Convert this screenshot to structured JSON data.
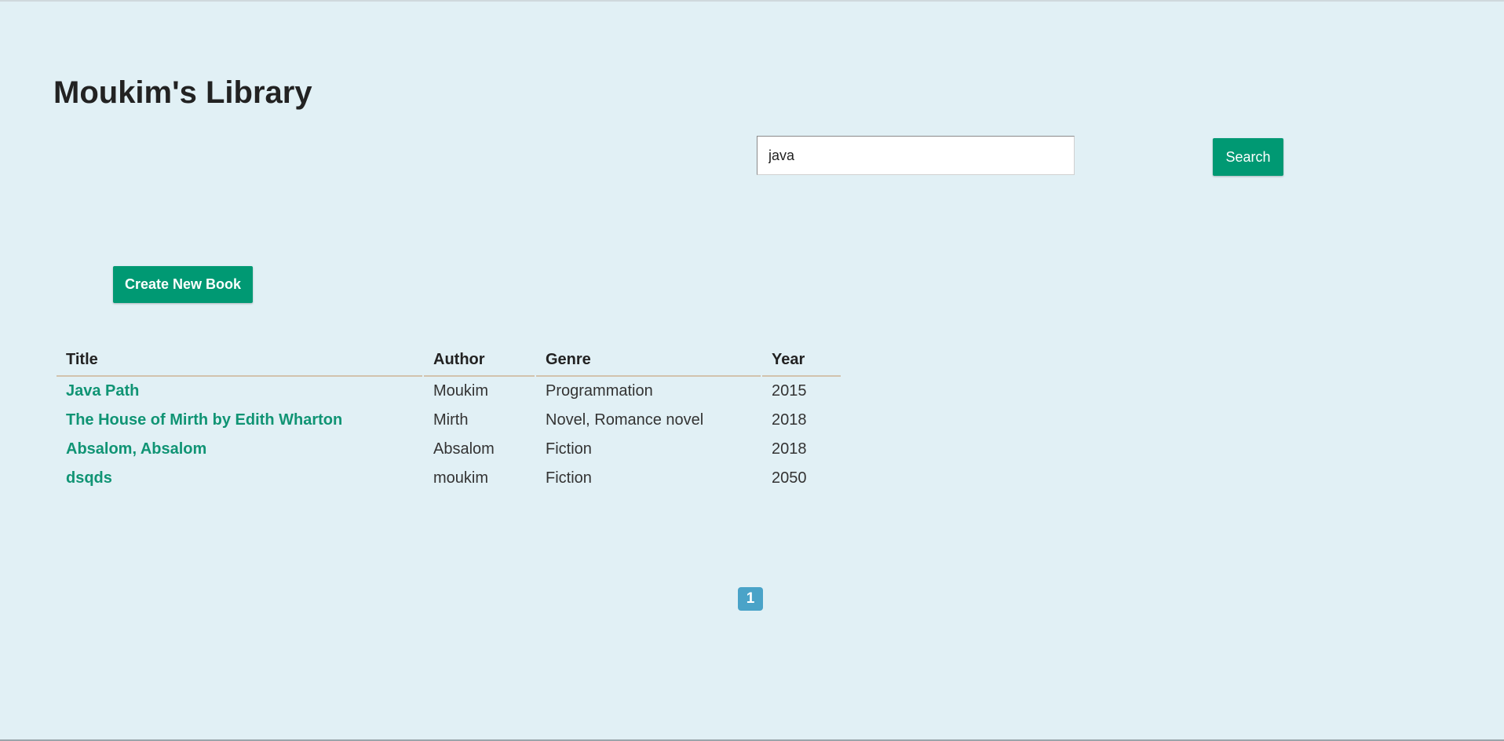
{
  "header": {
    "title": "Moukim's Library"
  },
  "search": {
    "value": "java",
    "button_label": "Search"
  },
  "actions": {
    "create_label": "Create New Book"
  },
  "table": {
    "columns": [
      "Title",
      "Author",
      "Genre",
      "Year"
    ],
    "rows": [
      {
        "title": "Java Path",
        "author": "Moukim",
        "genre": "Programmation",
        "year": "2015"
      },
      {
        "title": "The House of Mirth by Edith Wharton",
        "author": "Mirth",
        "genre": "Novel, Romance novel",
        "year": "2018"
      },
      {
        "title": "Absalom, Absalom",
        "author": "Absalom",
        "genre": "Fiction",
        "year": "2018"
      },
      {
        "title": "dsqds",
        "author": "moukim",
        "genre": "Fiction",
        "year": "2050"
      }
    ]
  },
  "pagination": {
    "current_page": "1"
  },
  "colors": {
    "background": "#e1f0f5",
    "accent": "#009973",
    "link": "#109474",
    "pagination": "#4aa3c8"
  }
}
